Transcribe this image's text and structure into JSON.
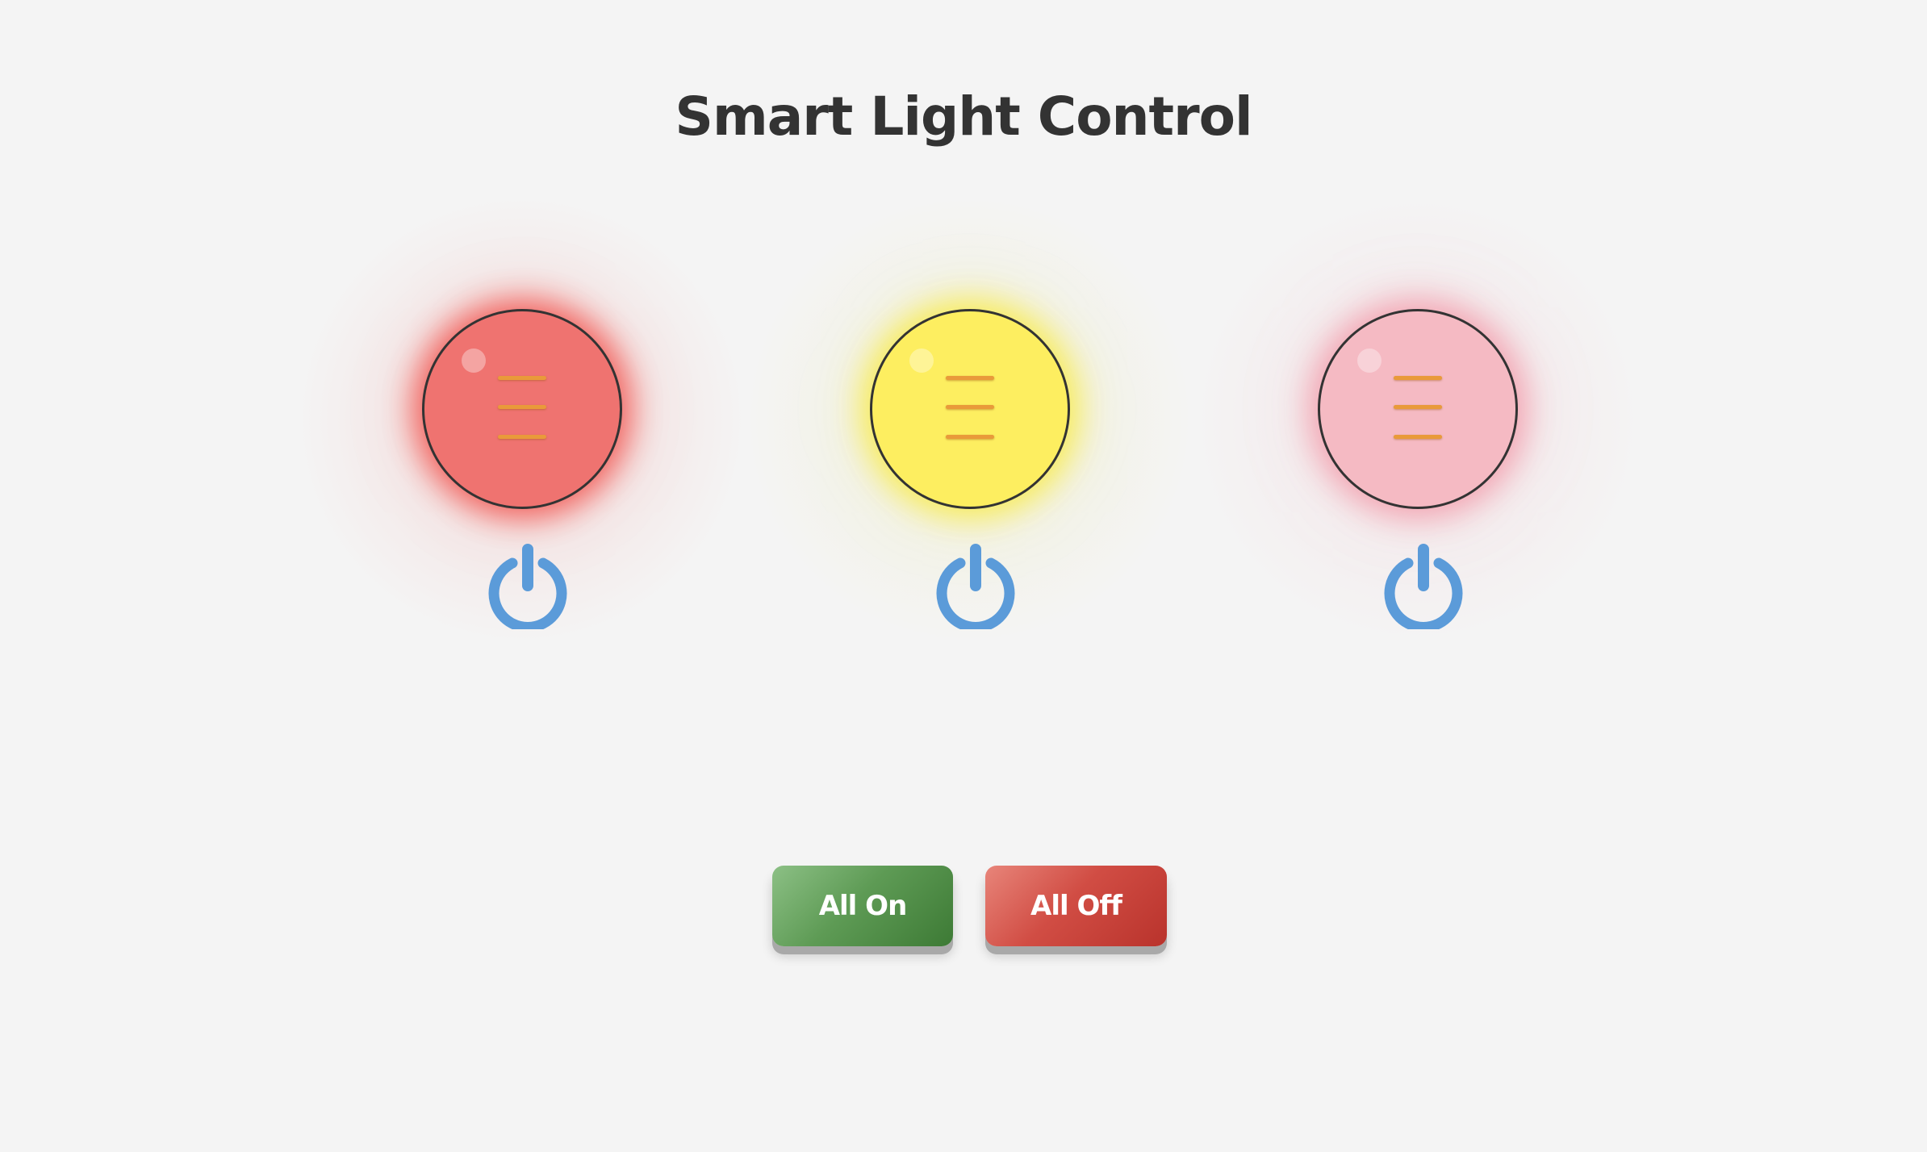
{
  "page": {
    "title": "Smart Light Control"
  },
  "lights": [
    {
      "color": "#ef7370",
      "glow": "#f25d58",
      "halo": "rgba(242,93,88,0.06)",
      "state": "on"
    },
    {
      "color": "#fdee60",
      "glow": "#f8ec55",
      "halo": "rgba(230,225,110,0.07)",
      "state": "on"
    },
    {
      "color": "#f5bac3",
      "glow": "#f3a3b1",
      "halo": "rgba(240,170,185,0.07)",
      "state": "on"
    }
  ],
  "power_icon": {
    "name": "power-icon",
    "color": "#5b9bd9"
  },
  "controls": {
    "all_on_label": "All On",
    "all_off_label": "All Off"
  }
}
